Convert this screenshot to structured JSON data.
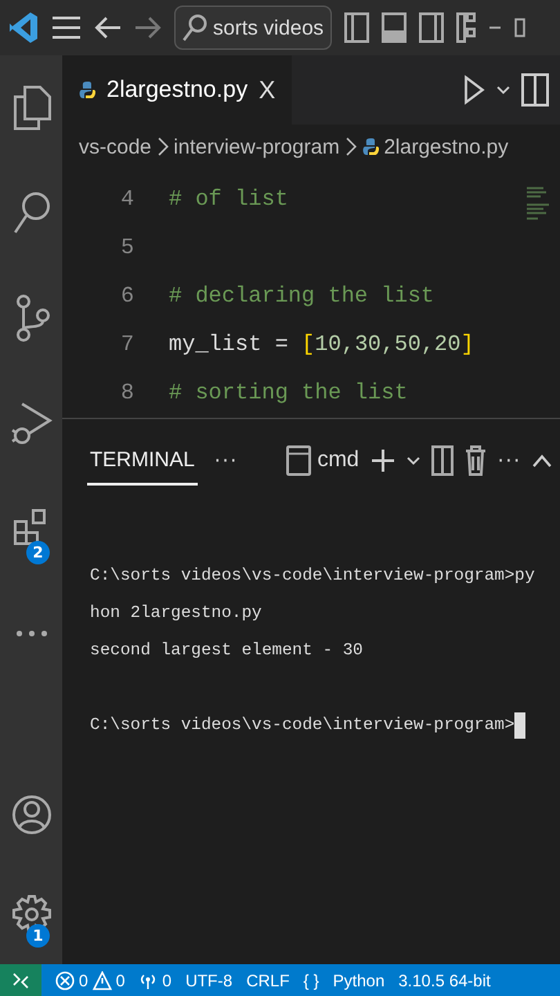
{
  "title_bar": {
    "search": "sorts videos"
  },
  "activity_bar": [
    {
      "kind": "explorer"
    },
    {
      "kind": "search"
    },
    {
      "kind": "source-control"
    },
    {
      "kind": "run-debug"
    },
    {
      "kind": "extensions",
      "badge": "2"
    },
    {
      "kind": "more"
    }
  ],
  "activity_bar_bottom": [
    {
      "kind": "account"
    },
    {
      "kind": "settings",
      "badge": "1"
    }
  ],
  "tabs": [
    {
      "label": "2largestno.py",
      "selected": true,
      "close": "X"
    }
  ],
  "breadcrumbs": [
    "vs-code",
    "interview-program",
    "2largestno.py"
  ],
  "editor": {
    "lines": [
      {
        "number": "4",
        "tokens": [
          {
            "kind": "comment",
            "text": "# of list"
          }
        ]
      },
      {
        "number": "5"
      },
      {
        "number": "6",
        "tokens": [
          {
            "kind": "comment",
            "text": "# declaring the list"
          }
        ]
      },
      {
        "number": "7",
        "tokens": [
          {
            "kind": "variable",
            "text": "my_list"
          },
          {
            "kind": "operator",
            "text": " = "
          },
          {
            "kind": "bracket",
            "text": "["
          },
          {
            "kind": "number",
            "text": "10,30,50,20"
          },
          {
            "kind": "bracket",
            "text": "]"
          }
        ]
      },
      {
        "number": "8",
        "tokens": [
          {
            "kind": "comment",
            "text": "# sorting the list"
          }
        ]
      }
    ]
  },
  "panel": {
    "tabs": [
      {
        "label": "TERMINAL",
        "selected": true
      }
    ],
    "more": "···",
    "shell": "cmd",
    "actions_more": "···",
    "terminal_blocks": [
      [
        "C:\\sorts videos\\vs-code\\interview-program>py",
        "hon 2largestno.py",
        "second largest element - 30"
      ],
      [
        "C:\\sorts videos\\vs-code\\interview-program>"
      ]
    ],
    "cursor": true
  },
  "status_bar": {
    "errors": "0",
    "warnings": "0",
    "ports": "0",
    "items": [
      "UTF-8",
      "CRLF",
      "{ }",
      "Python",
      "3.10.5 64-bit"
    ]
  }
}
